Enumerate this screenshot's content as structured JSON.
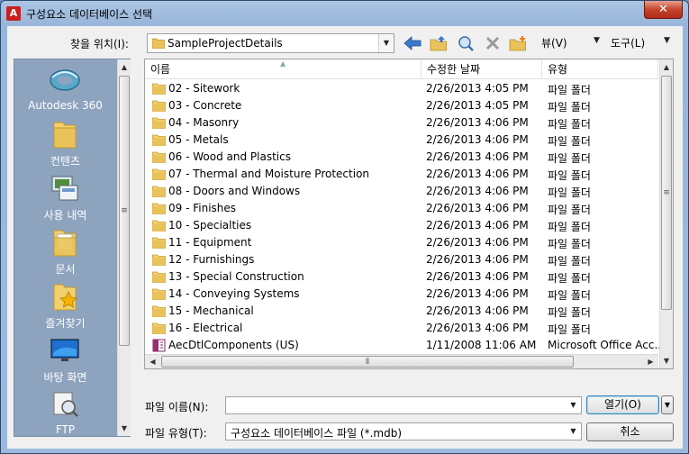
{
  "window": {
    "title": "구성요소 데이터베이스 선택",
    "close": "✕",
    "app_icon": "autocad-icon"
  },
  "toolbar": {
    "look_in_label": "찾을 위치(I):",
    "look_in_value": "SampleProjectDetails",
    "icons": [
      "back-arrow-icon",
      "up-folder-icon",
      "search-web-icon",
      "delete-icon",
      "new-folder-icon"
    ],
    "views_label": "뷰(V)",
    "tools_label": "도구(L)"
  },
  "places": [
    {
      "label": "Autodesk 360",
      "icon": "autodesk-360-icon"
    },
    {
      "label": "컨텐츠",
      "icon": "content-folder-icon"
    },
    {
      "label": "사용 내역",
      "icon": "history-icon"
    },
    {
      "label": "문서",
      "icon": "documents-icon"
    },
    {
      "label": "즐겨찾기",
      "icon": "favorites-icon"
    },
    {
      "label": "바탕 화면",
      "icon": "desktop-icon"
    },
    {
      "label": "FTP",
      "icon": "ftp-icon"
    }
  ],
  "columns": {
    "name": "이름",
    "date": "수정한 날짜",
    "type": "유형"
  },
  "files": [
    {
      "name": "02 - Sitework",
      "date": "2/26/2013 4:05 PM",
      "type": "파일 폴더",
      "kind": "folder"
    },
    {
      "name": "03 - Concrete",
      "date": "2/26/2013 4:05 PM",
      "type": "파일 폴더",
      "kind": "folder"
    },
    {
      "name": "04 - Masonry",
      "date": "2/26/2013 4:06 PM",
      "type": "파일 폴더",
      "kind": "folder"
    },
    {
      "name": "05 - Metals",
      "date": "2/26/2013 4:06 PM",
      "type": "파일 폴더",
      "kind": "folder"
    },
    {
      "name": "06 - Wood and Plastics",
      "date": "2/26/2013 4:06 PM",
      "type": "파일 폴더",
      "kind": "folder"
    },
    {
      "name": "07 - Thermal and Moisture Protection",
      "date": "2/26/2013 4:06 PM",
      "type": "파일 폴더",
      "kind": "folder"
    },
    {
      "name": "08 - Doors and Windows",
      "date": "2/26/2013 4:06 PM",
      "type": "파일 폴더",
      "kind": "folder"
    },
    {
      "name": "09 - Finishes",
      "date": "2/26/2013 4:06 PM",
      "type": "파일 폴더",
      "kind": "folder"
    },
    {
      "name": "10 - Specialties",
      "date": "2/26/2013 4:06 PM",
      "type": "파일 폴더",
      "kind": "folder"
    },
    {
      "name": "11 - Equipment",
      "date": "2/26/2013 4:06 PM",
      "type": "파일 폴더",
      "kind": "folder"
    },
    {
      "name": "12 - Furnishings",
      "date": "2/26/2013 4:06 PM",
      "type": "파일 폴더",
      "kind": "folder"
    },
    {
      "name": "13 - Special Construction",
      "date": "2/26/2013 4:06 PM",
      "type": "파일 폴더",
      "kind": "folder"
    },
    {
      "name": "14 - Conveying Systems",
      "date": "2/26/2013 4:06 PM",
      "type": "파일 폴더",
      "kind": "folder"
    },
    {
      "name": "15 - Mechanical",
      "date": "2/26/2013 4:06 PM",
      "type": "파일 폴더",
      "kind": "folder"
    },
    {
      "name": "16 - Electrical",
      "date": "2/26/2013 4:06 PM",
      "type": "파일 폴더",
      "kind": "folder"
    },
    {
      "name": "AecDtlComponents (US)",
      "date": "1/11/2008 11:06 AM",
      "type": "Microsoft Office Acc...",
      "kind": "mdb"
    }
  ],
  "bottom": {
    "file_name_label": "파일 이름(N):",
    "file_name_value": "",
    "file_type_label": "파일 유형(T):",
    "file_type_value": "구성요소 데이터베이스 파일 (*.mdb)",
    "open_label": "열기(O)",
    "cancel_label": "취소"
  },
  "colors": {
    "folder": "#e9c35a",
    "places_bg": "#8ea3be",
    "title_bg": "#aac4e2",
    "close": "#c7452c"
  }
}
